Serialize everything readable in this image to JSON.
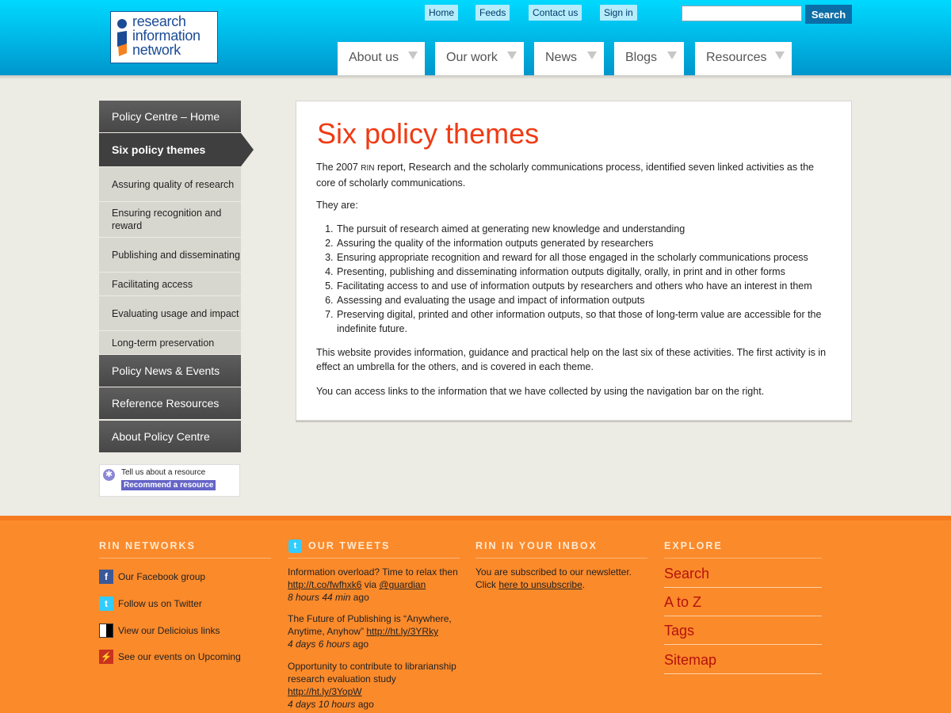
{
  "header": {
    "logo": {
      "line1": "research",
      "line2": "information",
      "line3": "network"
    },
    "top_links": [
      "Home",
      "Feeds",
      "Contact us",
      "Sign in"
    ],
    "search": {
      "value": "",
      "button_label": "Search"
    },
    "tabs": [
      "About us",
      "Our work",
      "News",
      "Blogs",
      "Resources"
    ]
  },
  "sidebar": {
    "home": "Policy Centre – Home",
    "active": "Six policy themes",
    "subitems": [
      "Assuring quality of research",
      "Ensuring recognition and reward",
      "Publishing and disseminating",
      "Facilitating access",
      "Evaluating usage and impact",
      "Long-term preservation"
    ],
    "sections": [
      "Policy News & Events",
      "Reference Resources",
      "About Policy Centre"
    ],
    "recommend": {
      "text": "Tell us about a resource",
      "button": "Recommend a resource"
    }
  },
  "content": {
    "title": "Six policy themes",
    "intro_a": "The 2007 ",
    "intro_rin": "RIN",
    "intro_b": " report, Research and the scholarly communications process, identified seven linked activities as the core of scholarly communications.",
    "they_are": "They are:",
    "list": [
      "The pursuit of research aimed at generating new knowledge and understanding",
      "Assuring the quality of the information outputs generated by researchers",
      "Ensuring appropriate recognition and reward for all those engaged in the scholarly communications process",
      "Presenting, publishing and disseminating information outputs digitally, orally, in print and in other forms",
      "Facilitating access to and use of information outputs by researchers and others who have an interest in them",
      "Assessing and evaluating the usage and impact of information outputs",
      "Preserving digital, printed and other information outputs, so that those of long-term value are accessible for the indefinite future."
    ],
    "para2": "This website provides information, guidance and practical help on the last six of these activities. The first activity is in effect an umbrella for the others, and is covered in each theme.",
    "para3": "You can access links to the information that we have collected by using the navigation bar on the right."
  },
  "footer": {
    "networks": {
      "heading": "RIN NETWORKS",
      "items": [
        "Our Facebook group",
        "Follow us on Twitter",
        "View our Delicioius links",
        "See our events on Upcoming"
      ]
    },
    "tweets": {
      "heading": "OUR TWEETS",
      "items": [
        {
          "text": "Information overload? Time to relax then ",
          "link": "http://t.co/fwfhxk6",
          "via": " via ",
          "user": "@guardian",
          "ago": "8 hours 44 min",
          "ago_suffix": " ago"
        },
        {
          "text": "The Future of Publishing is “Anywhere, Anytime, Anyhow” ",
          "link": "http://ht.ly/3YRky",
          "ago": "4 days 6 hours",
          "ago_suffix": " ago"
        },
        {
          "text": "Opportunity to contribute to librarianship research evaluation study ",
          "link": "http://ht.ly/3YopW",
          "ago": "4 days 10 hours",
          "ago_suffix": " ago"
        }
      ]
    },
    "inbox": {
      "heading": "RIN IN YOUR INBOX",
      "text": "You are subscribed to our newsletter. Click ",
      "link": "here to unsubscribe",
      "end": "."
    },
    "explore": {
      "heading": "EXPLORE",
      "links": [
        "Search",
        "A to Z",
        "Tags",
        "Sitemap"
      ]
    }
  },
  "colors": {
    "accent_red": "#ef3b14",
    "footer_orange": "#fb8a2b",
    "header_blue": "#00bfec"
  }
}
